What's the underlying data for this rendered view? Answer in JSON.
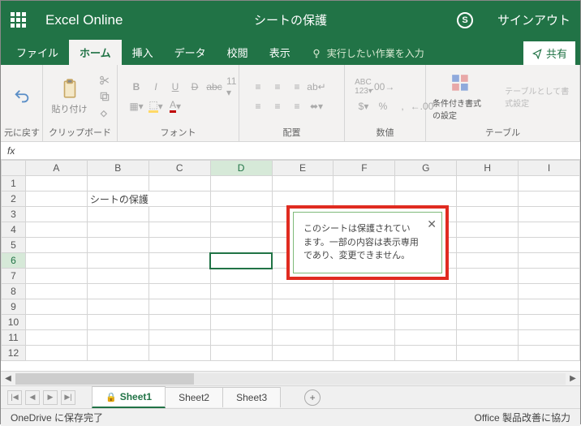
{
  "title": {
    "app": "Excel Online",
    "doc": "シートの保護",
    "signout": "サインアウト"
  },
  "tabs": {
    "file": "ファイル",
    "home": "ホーム",
    "insert": "挿入",
    "data": "データ",
    "review": "校閲",
    "view": "表示",
    "tellme": "実行したい作業を入力",
    "share": "共有"
  },
  "ribbon": {
    "undo": "元に戻す",
    "paste": "貼り付け",
    "clipboard": "クリップボード",
    "font": "フォント",
    "alignment": "配置",
    "number": "数値",
    "condfmt": "条件付き書式の設定",
    "tablefmt": "テーブルとして書式設定",
    "tables": "テーブル"
  },
  "grid": {
    "columns": [
      "A",
      "B",
      "C",
      "D",
      "E",
      "F",
      "G",
      "H",
      "I"
    ],
    "rows": [
      1,
      2,
      3,
      4,
      5,
      6,
      7,
      8,
      9,
      10,
      11,
      12
    ],
    "b2": "シートの保護",
    "selected": {
      "col": "D",
      "row": 6
    }
  },
  "tooltip": {
    "text": "このシートは保護されています。一部の内容は表示専用であり、変更できません。"
  },
  "sheets": {
    "s1": "Sheet1",
    "s2": "Sheet2",
    "s3": "Sheet3"
  },
  "status": {
    "left": "OneDrive に保存完了",
    "right": "Office 製品改善に協力"
  }
}
